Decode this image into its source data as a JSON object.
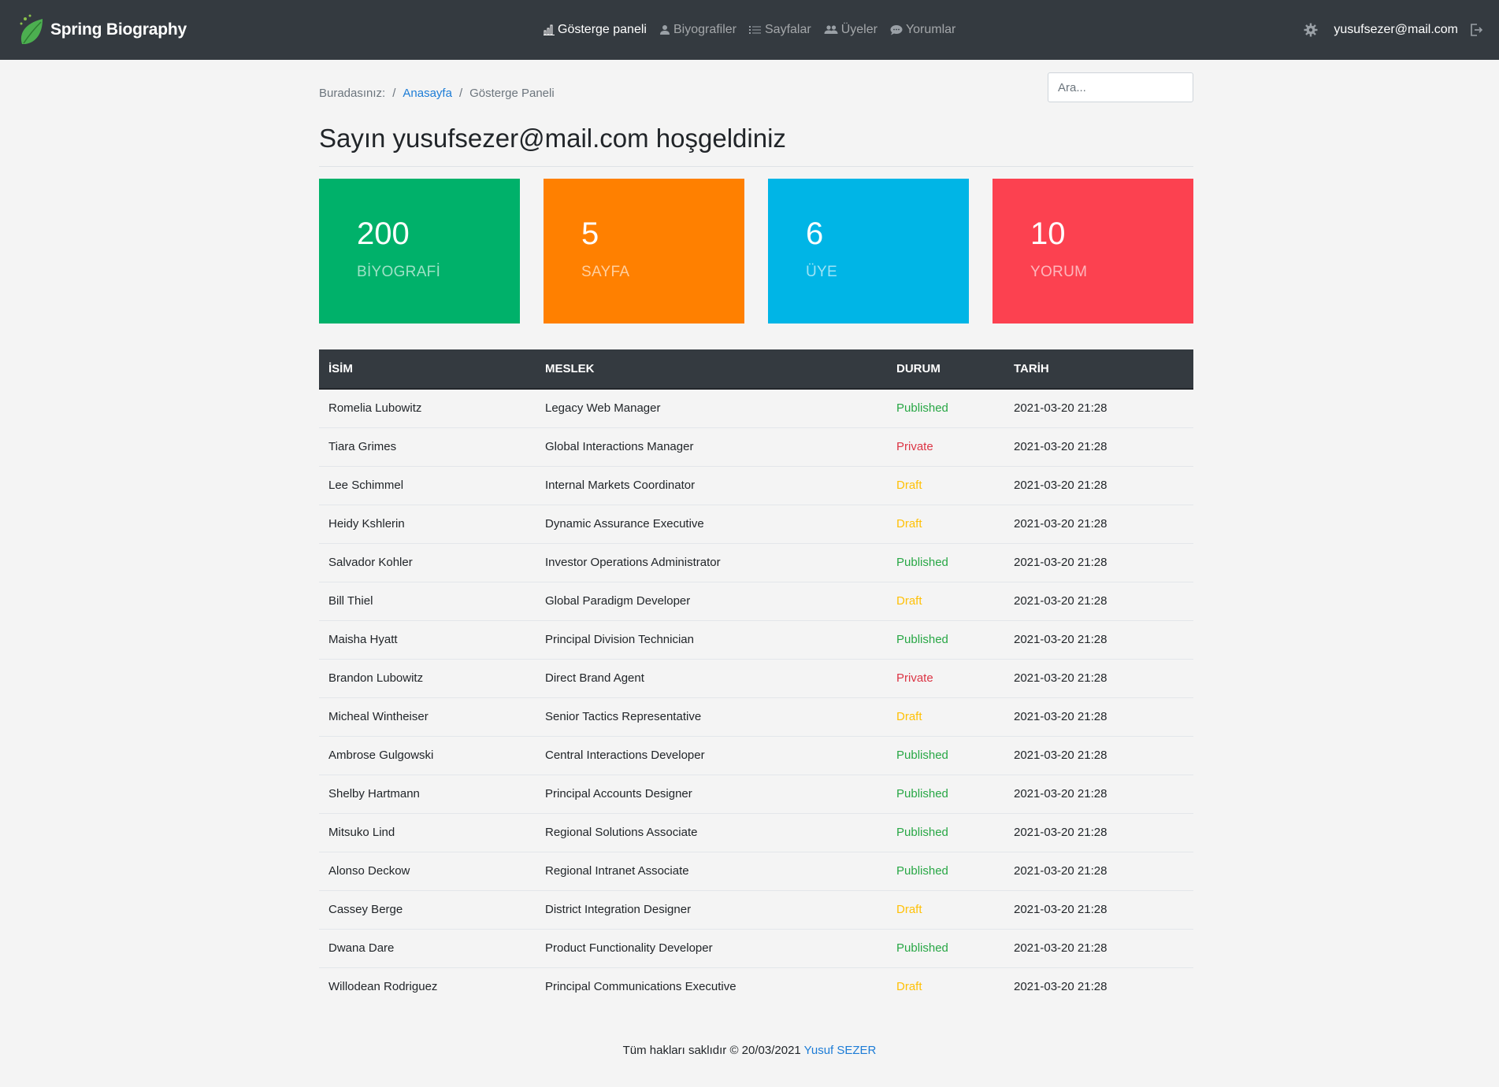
{
  "brand": {
    "name": "Spring Biography"
  },
  "nav": {
    "items": [
      {
        "label": "Gösterge paneli",
        "icon": "bar-chart-icon",
        "active": true
      },
      {
        "label": "Biyografiler",
        "icon": "person-icon",
        "active": false
      },
      {
        "label": "Sayfalar",
        "icon": "list-icon",
        "active": false
      },
      {
        "label": "Üyeler",
        "icon": "people-icon",
        "active": false
      },
      {
        "label": "Yorumlar",
        "icon": "chat-icon",
        "active": false
      }
    ],
    "user_email": "yusufsezer@mail.com"
  },
  "breadcrumb": {
    "prefix": "Buradasınız:",
    "home": "Anasayfa",
    "current": "Gösterge Paneli"
  },
  "search": {
    "placeholder": "Ara..."
  },
  "page_title": "Sayın yusufsezer@mail.com hoşgeldiniz",
  "cards": [
    {
      "value": "200",
      "label": "BİYOGRAFİ",
      "color": "#00b16a"
    },
    {
      "value": "5",
      "label": "SAYFA",
      "color": "#ff8000"
    },
    {
      "value": "6",
      "label": "ÜYE",
      "color": "#00b5e6"
    },
    {
      "value": "10",
      "label": "YORUM",
      "color": "#fc4150"
    }
  ],
  "table": {
    "headers": [
      "İSİM",
      "MESLEK",
      "DURUM",
      "TARİH"
    ],
    "rows": [
      [
        "Romelia Lubowitz",
        "Legacy Web Manager",
        "Published",
        "2021-03-20 21:28"
      ],
      [
        "Tiara Grimes",
        "Global Interactions Manager",
        "Private",
        "2021-03-20 21:28"
      ],
      [
        "Lee Schimmel",
        "Internal Markets Coordinator",
        "Draft",
        "2021-03-20 21:28"
      ],
      [
        "Heidy Kshlerin",
        "Dynamic Assurance Executive",
        "Draft",
        "2021-03-20 21:28"
      ],
      [
        "Salvador Kohler",
        "Investor Operations Administrator",
        "Published",
        "2021-03-20 21:28"
      ],
      [
        "Bill Thiel",
        "Global Paradigm Developer",
        "Draft",
        "2021-03-20 21:28"
      ],
      [
        "Maisha Hyatt",
        "Principal Division Technician",
        "Published",
        "2021-03-20 21:28"
      ],
      [
        "Brandon Lubowitz",
        "Direct Brand Agent",
        "Private",
        "2021-03-20 21:28"
      ],
      [
        "Micheal Wintheiser",
        "Senior Tactics Representative",
        "Draft",
        "2021-03-20 21:28"
      ],
      [
        "Ambrose Gulgowski",
        "Central Interactions Developer",
        "Published",
        "2021-03-20 21:28"
      ],
      [
        "Shelby Hartmann",
        "Principal Accounts Designer",
        "Published",
        "2021-03-20 21:28"
      ],
      [
        "Mitsuko Lind",
        "Regional Solutions Associate",
        "Published",
        "2021-03-20 21:28"
      ],
      [
        "Alonso Deckow",
        "Regional Intranet Associate",
        "Published",
        "2021-03-20 21:28"
      ],
      [
        "Cassey Berge",
        "District Integration Designer",
        "Draft",
        "2021-03-20 21:28"
      ],
      [
        "Dwana Dare",
        "Product Functionality Developer",
        "Published",
        "2021-03-20 21:28"
      ],
      [
        "Willodean Rodriguez",
        "Principal Communications Executive",
        "Draft",
        "2021-03-20 21:28"
      ]
    ]
  },
  "footer": {
    "text": "Tüm hakları saklıdır © 20/03/2021",
    "author": "Yusuf SEZER"
  }
}
